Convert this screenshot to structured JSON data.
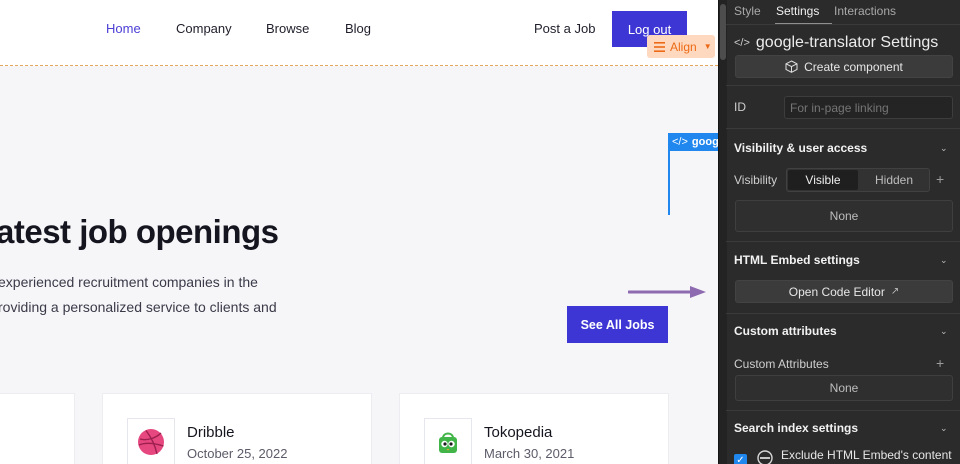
{
  "nav": {
    "links": [
      "Home",
      "Company",
      "Browse",
      "Blog"
    ],
    "post_job": "Post a Job",
    "logout": "Log out",
    "align": "Align"
  },
  "embed_tag": "googl",
  "hero": {
    "title": "atest job openings",
    "line1": "experienced recruitment companies in the",
    "line2": "roviding a personalized service to clients and",
    "see_all": "See All Jobs"
  },
  "cards": [
    {
      "name": "Dribble",
      "date": "October 25, 2022"
    },
    {
      "name": "Tokopedia",
      "date": "March 30, 2021"
    }
  ],
  "panel": {
    "tabs": [
      "Style",
      "Settings",
      "Interactions"
    ],
    "element_title": "google-translator Settings",
    "create_component": "Create component",
    "id_label": "ID",
    "id_placeholder": "For in-page linking",
    "visibility_head": "Visibility & user access",
    "visibility_label": "Visibility",
    "visible": "Visible",
    "hidden": "Hidden",
    "none1": "None",
    "embed_head": "HTML Embed settings",
    "open_code": "Open Code Editor",
    "custom_head": "Custom attributes",
    "custom_label": "Custom Attributes",
    "none2": "None",
    "search_head": "Search index settings",
    "exclude_label": "Exclude HTML Embed's content"
  },
  "colors": {
    "accent": "#3e36d4",
    "selection": "#1f87ee",
    "align_chip": "#ffd9bf"
  }
}
